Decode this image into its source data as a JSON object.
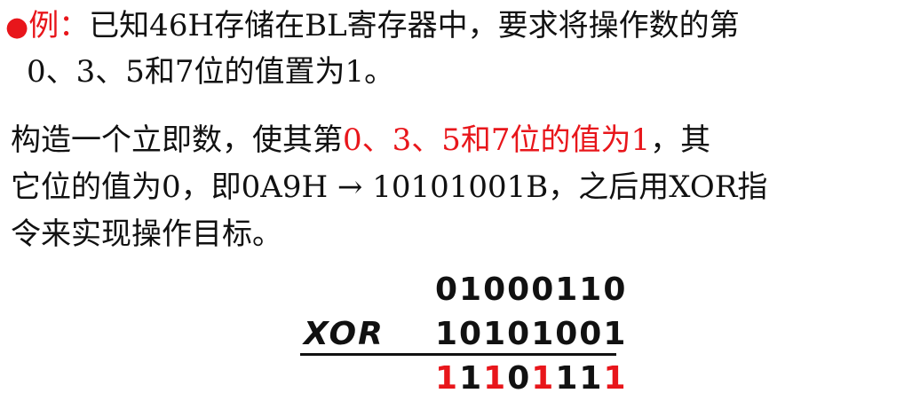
{
  "example": {
    "bullet": "●",
    "label": "例：",
    "line1": "已知46H存储在BL寄存器中，要求将操作数的第",
    "line2": "0、3、5和7位的值置为1。"
  },
  "explanation": {
    "line1_a": "构造一个立即数，使其第",
    "line1_red": "0、3、5和7位的值为1",
    "line1_b": "，其",
    "line2": "它位的值为0，即0A9H → 10101001B，之后用XOR指",
    "line3": "令来实现操作目标。"
  },
  "calculation": {
    "operand1": "01000110",
    "operator": "XOR",
    "operand2": "10101001",
    "result_digits": [
      {
        "d": "1",
        "changed": true
      },
      {
        "d": "1",
        "changed": false
      },
      {
        "d": "1",
        "changed": true
      },
      {
        "d": "0",
        "changed": false
      },
      {
        "d": "1",
        "changed": true
      },
      {
        "d": "1",
        "changed": false
      },
      {
        "d": "1",
        "changed": false
      },
      {
        "d": "1",
        "changed": true
      }
    ],
    "colors": {
      "text": "#111111",
      "highlight": "#e8161b"
    }
  }
}
